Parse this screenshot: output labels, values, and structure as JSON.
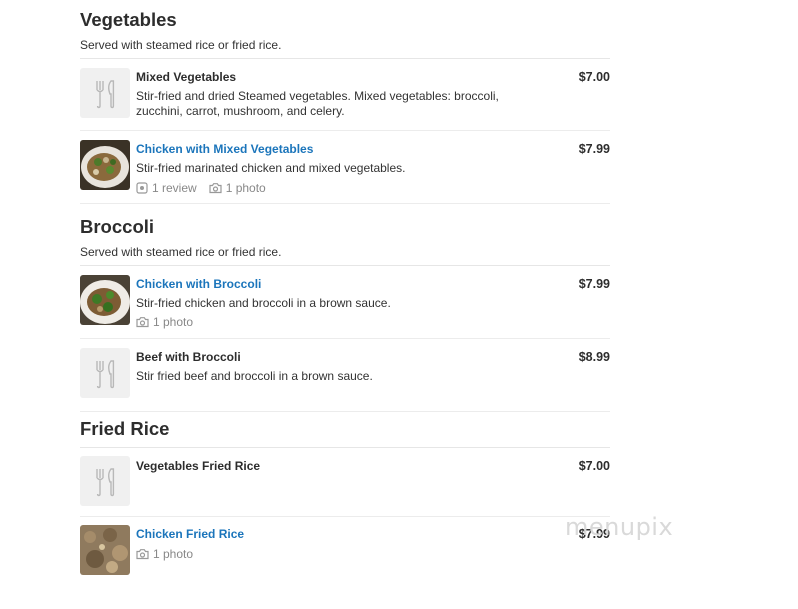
{
  "sections": [
    {
      "title": "Vegetables",
      "description": "Served with steamed rice or fried rice.",
      "items": [
        {
          "name": "Mixed Vegetables",
          "price": "$7.00",
          "description": "Stir-fried and dried Steamed vegetables. Mixed vegetables: broccoli, zucchini, carrot, mushroom, and celery."
        },
        {
          "name": "Chicken with Mixed Vegetables",
          "price": "$7.99",
          "description": "Stir-fried marinated chicken and mixed vegetables.",
          "reviews": "1 review",
          "photos": "1 photo"
        }
      ]
    },
    {
      "title": "Broccoli",
      "description": "Served with steamed rice or fried rice.",
      "items": [
        {
          "name": "Chicken with Broccoli",
          "price": "$7.99",
          "description": "Stir-fried chicken and broccoli in a brown sauce.",
          "photos": "1 photo"
        },
        {
          "name": "Beef with Broccoli",
          "price": "$8.99",
          "description": "Stir fried beef and broccoli in a brown sauce."
        }
      ]
    },
    {
      "title": "Fried Rice",
      "items": [
        {
          "name": "Vegetables Fried Rice",
          "price": "$7.00"
        },
        {
          "name": "Chicken Fried Rice",
          "price": "$7.99",
          "photos": "1 photo"
        }
      ]
    }
  ],
  "watermark": "menupix",
  "icons": {
    "placeholder": "utensils-icon",
    "review": "review-icon",
    "photo": "camera-icon"
  },
  "colors": {
    "link": "#1b75bb",
    "text": "#2d2d2d",
    "meta": "#888888"
  }
}
